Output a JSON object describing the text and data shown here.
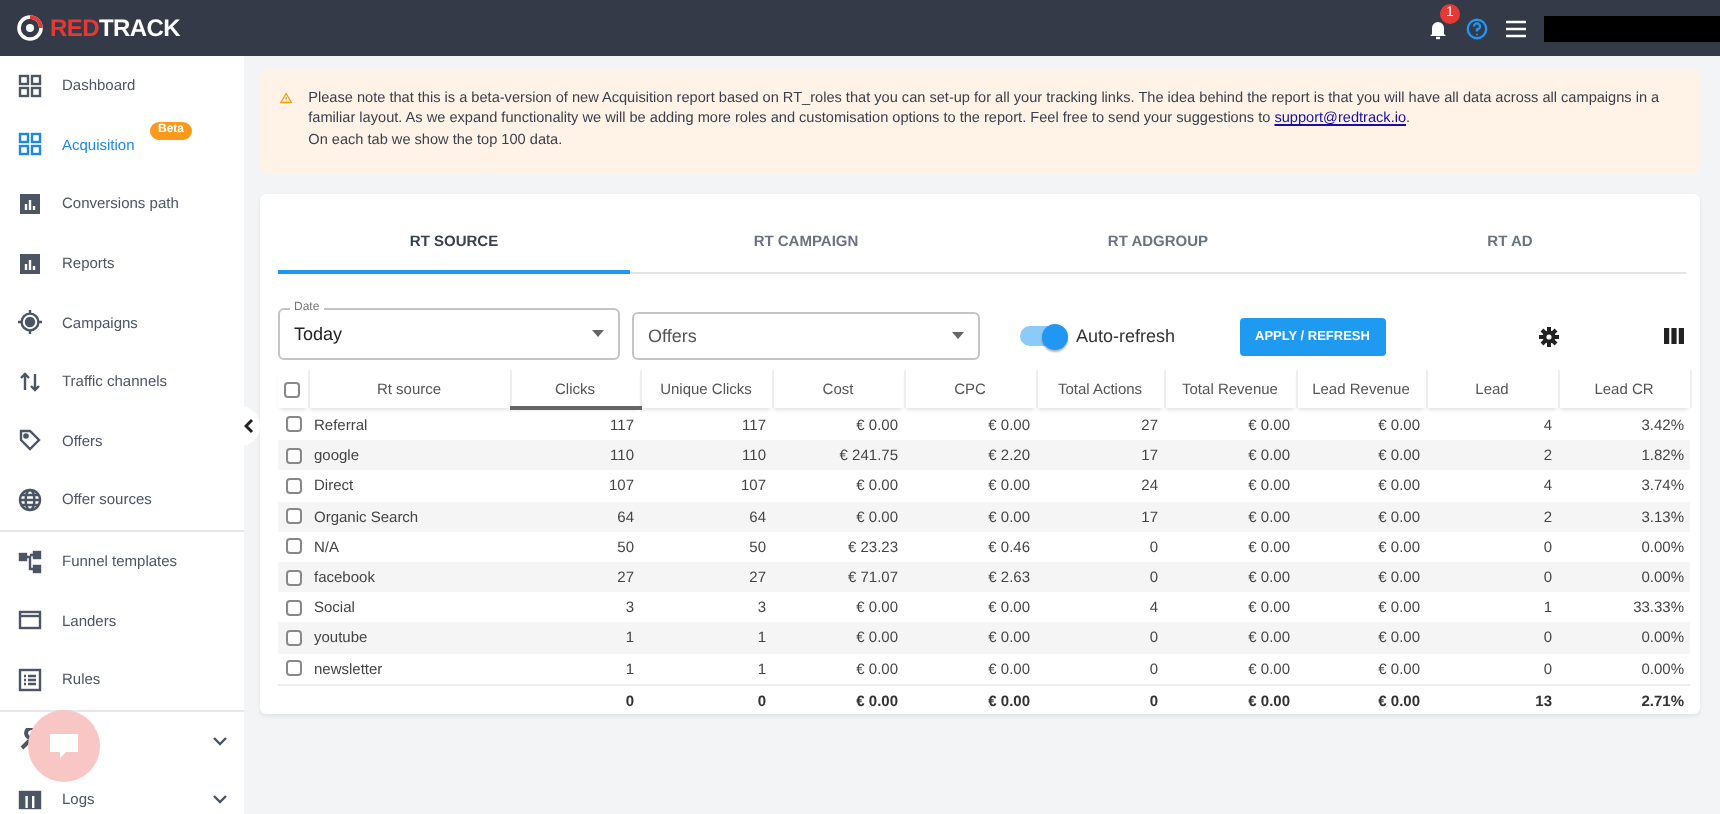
{
  "topbar": {
    "logo": {
      "accent": "RED",
      "rest": "TRACK"
    },
    "notification_count": "1"
  },
  "sidebar": {
    "groups": [
      [
        {
          "label": "Dashboard",
          "selected": false
        },
        {
          "label": "Acquisition",
          "selected": true,
          "badge": "Beta"
        },
        {
          "label": "Conversions path",
          "selected": false
        },
        {
          "label": "Reports",
          "selected": false
        },
        {
          "label": "Campaigns",
          "selected": false
        },
        {
          "label": "Traffic channels",
          "selected": false
        },
        {
          "label": "Offers",
          "selected": false
        },
        {
          "label": "Offer sources",
          "selected": false
        }
      ],
      [
        {
          "label": "Funnel templates",
          "selected": false
        },
        {
          "label": "Landers",
          "selected": false
        },
        {
          "label": "Rules",
          "selected": false
        }
      ],
      [
        {
          "selected": false,
          "expandable": true
        },
        {
          "label": "Logs",
          "selected": false,
          "expandable": true
        }
      ]
    ]
  },
  "notice": {
    "text": "Please note that this is a beta-version of new Acquisition report based on RT_roles that you can set-up for all your tracking links. The idea behind the report is that you will have all data across all campaigns in a familiar layout. As we expand functionality we will be adding more roles and customisation options to the report. Feel free to send your suggestions to ",
    "link": "support@redtrack.io",
    "after": ".",
    "second_line": "On each tab we show the top 100 data."
  },
  "tabs": [
    {
      "label": "RT SOURCE",
      "selected": true
    },
    {
      "label": "RT CAMPAIGN",
      "selected": false
    },
    {
      "label": "RT ADGROUP",
      "selected": false
    },
    {
      "label": "RT AD",
      "selected": false
    }
  ],
  "filters": {
    "date": {
      "label": "Date",
      "value": "Today"
    },
    "offers": {
      "placeholder": "Offers"
    }
  },
  "auto_refresh": {
    "label": "Auto-refresh",
    "on": true
  },
  "apply_button": "APPLY / REFRESH",
  "table": {
    "select_all": false,
    "columns": [
      {
        "label": "Rt source",
        "sorted": false
      },
      {
        "label": "Clicks",
        "sorted": true
      },
      {
        "label": "Unique Clicks",
        "sorted": false
      },
      {
        "label": "Cost",
        "sorted": false
      },
      {
        "label": "CPC",
        "sorted": false
      },
      {
        "label": "Total Actions",
        "sorted": false
      },
      {
        "label": "Total Revenue",
        "sorted": false
      },
      {
        "label": "Lead Revenue",
        "sorted": false
      },
      {
        "label": "Lead",
        "sorted": false
      },
      {
        "label": "Lead CR",
        "sorted": false
      }
    ],
    "rows": [
      {
        "checked": false,
        "cells": [
          "Referral",
          "117",
          "117",
          "€ 0.00",
          "€ 0.00",
          "27",
          "€ 0.00",
          "€ 0.00",
          "4",
          "3.42%"
        ]
      },
      {
        "checked": false,
        "cells": [
          "google",
          "110",
          "110",
          "€ 241.75",
          "€ 2.20",
          "17",
          "€ 0.00",
          "€ 0.00",
          "2",
          "1.82%"
        ]
      },
      {
        "checked": false,
        "cells": [
          "Direct",
          "107",
          "107",
          "€ 0.00",
          "€ 0.00",
          "24",
          "€ 0.00",
          "€ 0.00",
          "4",
          "3.74%"
        ]
      },
      {
        "checked": false,
        "cells": [
          "Organic Search",
          "64",
          "64",
          "€ 0.00",
          "€ 0.00",
          "17",
          "€ 0.00",
          "€ 0.00",
          "2",
          "3.13%"
        ]
      },
      {
        "checked": false,
        "cells": [
          "N/A",
          "50",
          "50",
          "€ 23.23",
          "€ 0.46",
          "0",
          "€ 0.00",
          "€ 0.00",
          "0",
          "0.00%"
        ]
      },
      {
        "checked": false,
        "cells": [
          "facebook",
          "27",
          "27",
          "€ 71.07",
          "€ 2.63",
          "0",
          "€ 0.00",
          "€ 0.00",
          "0",
          "0.00%"
        ]
      },
      {
        "checked": false,
        "cells": [
          "Social",
          "3",
          "3",
          "€ 0.00",
          "€ 0.00",
          "4",
          "€ 0.00",
          "€ 0.00",
          "1",
          "33.33%"
        ]
      },
      {
        "checked": false,
        "cells": [
          "youtube",
          "1",
          "1",
          "€ 0.00",
          "€ 0.00",
          "0",
          "€ 0.00",
          "€ 0.00",
          "0",
          "0.00%"
        ]
      },
      {
        "checked": false,
        "cells": [
          "newsletter",
          "1",
          "1",
          "€ 0.00",
          "€ 0.00",
          "0",
          "€ 0.00",
          "€ 0.00",
          "0",
          "0.00%"
        ]
      }
    ],
    "totals": [
      "0",
      "0",
      "€ 0.00",
      "€ 0.00",
      "0",
      "€ 0.00",
      "€ 0.00",
      "13",
      "2.71%"
    ]
  }
}
